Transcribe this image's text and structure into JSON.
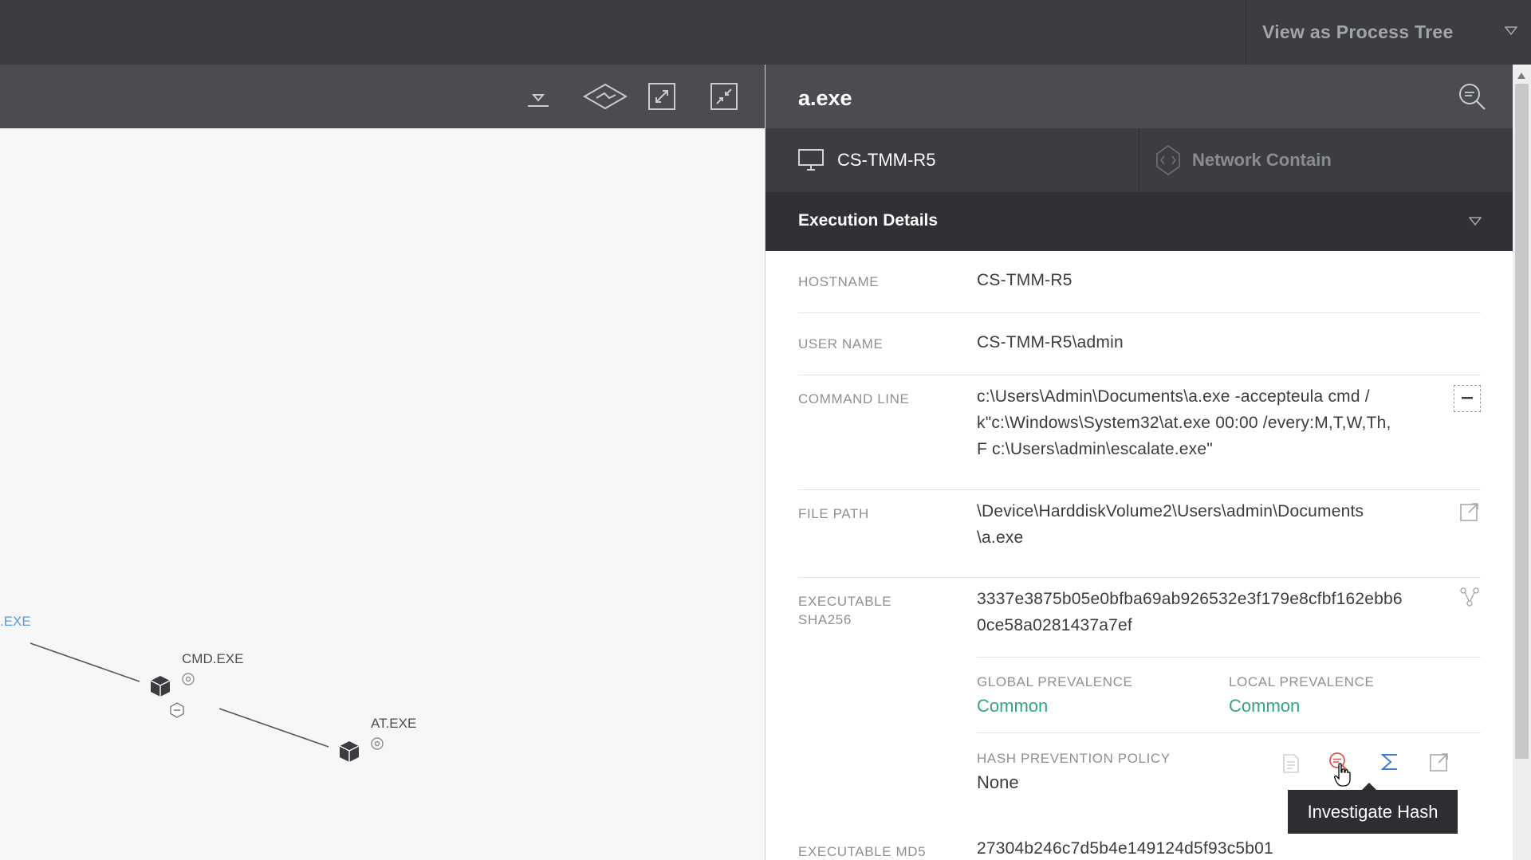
{
  "header": {
    "view_toggle_label": "View as Process Tree"
  },
  "toolbar": {
    "icons": [
      "download-icon",
      "layers-icon",
      "expand-icon",
      "collapse-icon"
    ]
  },
  "graph": {
    "nodes": [
      {
        "label": ".EXE"
      },
      {
        "label": "CMD.EXE"
      },
      {
        "label": "AT.EXE"
      }
    ]
  },
  "panel": {
    "title": "a.exe",
    "host_label": "CS-TMM-R5",
    "contain_label": "Network Contain",
    "section_title": "Execution Details",
    "fields": {
      "hostname": {
        "label": "HOSTNAME",
        "value": "CS-TMM-R5"
      },
      "username": {
        "label": "USER NAME",
        "value": "CS-TMM-R5\\admin"
      },
      "command_line": {
        "label": "COMMAND LINE",
        "lines": [
          "c:\\Users\\Admin\\Documents\\a.exe -accepteula cmd /",
          "k\"c:\\Windows\\System32\\at.exe 00:00 /every:M,T,W,Th,",
          "F c:\\Users\\admin\\escalate.exe\""
        ]
      },
      "file_path": {
        "label": "FILE PATH",
        "lines": [
          "\\Device\\HarddiskVolume2\\Users\\admin\\Documents",
          "\\a.exe"
        ]
      },
      "sha256": {
        "label_lines": [
          "EXECUTABLE",
          "SHA256"
        ],
        "lines": [
          "3337e3875b05e0bfba69ab926532e3f179e8cfbf162ebb6",
          "0ce58a0281437a7ef"
        ]
      },
      "global_prevalence": {
        "label": "GLOBAL PREVALENCE",
        "value": "Common"
      },
      "local_prevalence": {
        "label": "LOCAL PREVALENCE",
        "value": "Common"
      },
      "hash_policy": {
        "label": "HASH PREVENTION POLICY",
        "value": "None"
      },
      "md5": {
        "label": "EXECUTABLE MD5",
        "value": "27304b246c7d5b4e149124d5f93c5b01"
      }
    },
    "tooltip": "Investigate Hash"
  },
  "colors": {
    "topbar": "#3b3d40",
    "toolbar": "#4a4c4f",
    "prevalence": "#33a57f",
    "root_node": "#5b9bd5",
    "investigate_icon": "#e0544f",
    "sum_icon": "#3e7fd4"
  }
}
